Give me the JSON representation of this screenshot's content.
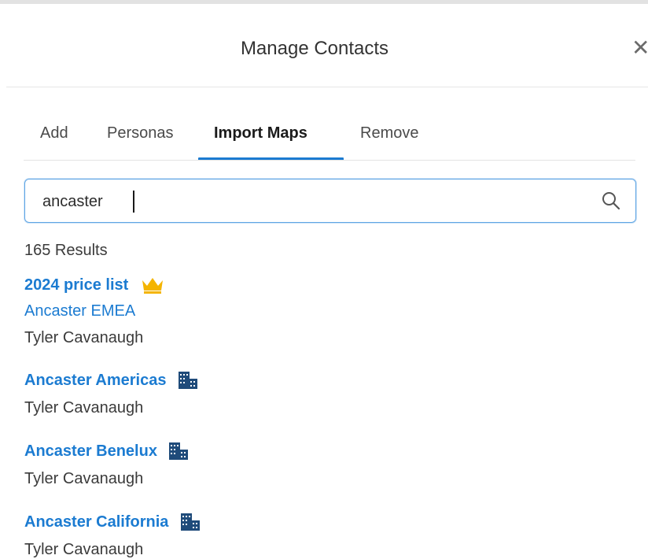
{
  "dialog": {
    "title": "Manage Contacts",
    "close_glyph": "✕"
  },
  "tabs": [
    {
      "label": "Add",
      "active": false
    },
    {
      "label": "Personas",
      "active": false
    },
    {
      "label": "Import Maps",
      "active": true
    },
    {
      "label": "Remove",
      "active": false
    }
  ],
  "search": {
    "value": "ancaster",
    "icon": "search-icon"
  },
  "results": {
    "count_label": "165 Results",
    "items": [
      {
        "title": "2024 price list",
        "badge": "crown-icon",
        "link": "Ancaster EMEA",
        "owner": "Tyler Cavanaugh"
      },
      {
        "title": "Ancaster Americas",
        "badge": "building-icon",
        "owner": "Tyler Cavanaugh"
      },
      {
        "title": "Ancaster Benelux",
        "badge": "building-icon",
        "owner": "Tyler Cavanaugh"
      },
      {
        "title": "Ancaster California",
        "badge": "building-icon",
        "owner": "Tyler Cavanaugh"
      }
    ]
  },
  "colors": {
    "accent": "#1b7bd1",
    "crown": "#f4b400",
    "building": "#1f4b7a"
  }
}
